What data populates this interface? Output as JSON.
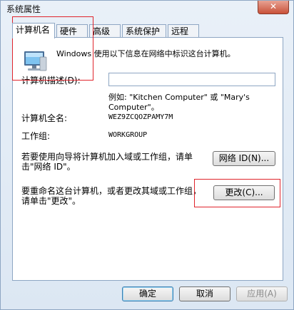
{
  "window": {
    "title": "系统属性",
    "close_glyph": "✕"
  },
  "tabs": [
    {
      "label": "计算机名",
      "active": true
    },
    {
      "label": "硬件",
      "active": false
    },
    {
      "label": "高级",
      "active": false
    },
    {
      "label": "系统保护",
      "active": false
    },
    {
      "label": "远程",
      "active": false
    }
  ],
  "panel": {
    "intro": "Windows 使用以下信息在网络中标识这台计算机。",
    "description_label": "计算机描述(D):",
    "description_value": "",
    "example_line1": "例如: \"Kitchen Computer\" 或 \"Mary's",
    "example_line2": "Computer\"。",
    "fullname_label": "计算机全名:",
    "fullname_value": "WEZ9ZCQOZPAMY7M",
    "workgroup_label": "工作组:",
    "workgroup_value": "WORKGROUP",
    "network_text_line1": "若要使用向导将计算机加入域或工作组，请单",
    "network_text_line2": "击\"网络 ID\"。",
    "network_id_button": "网络 ID(N)...",
    "rename_text_line1": "要重命名这台计算机，或者更改其域或工作组，",
    "rename_text_line2": "请单击\"更改\"。",
    "change_button": "更改(C)..."
  },
  "footer": {
    "ok_button": "确定",
    "cancel_button": "取消",
    "apply_button": "应用(A)"
  },
  "icons": {
    "computer": "computer-icon"
  },
  "colors": {
    "highlight": "#e0242c",
    "border": "#8ea6c3"
  }
}
